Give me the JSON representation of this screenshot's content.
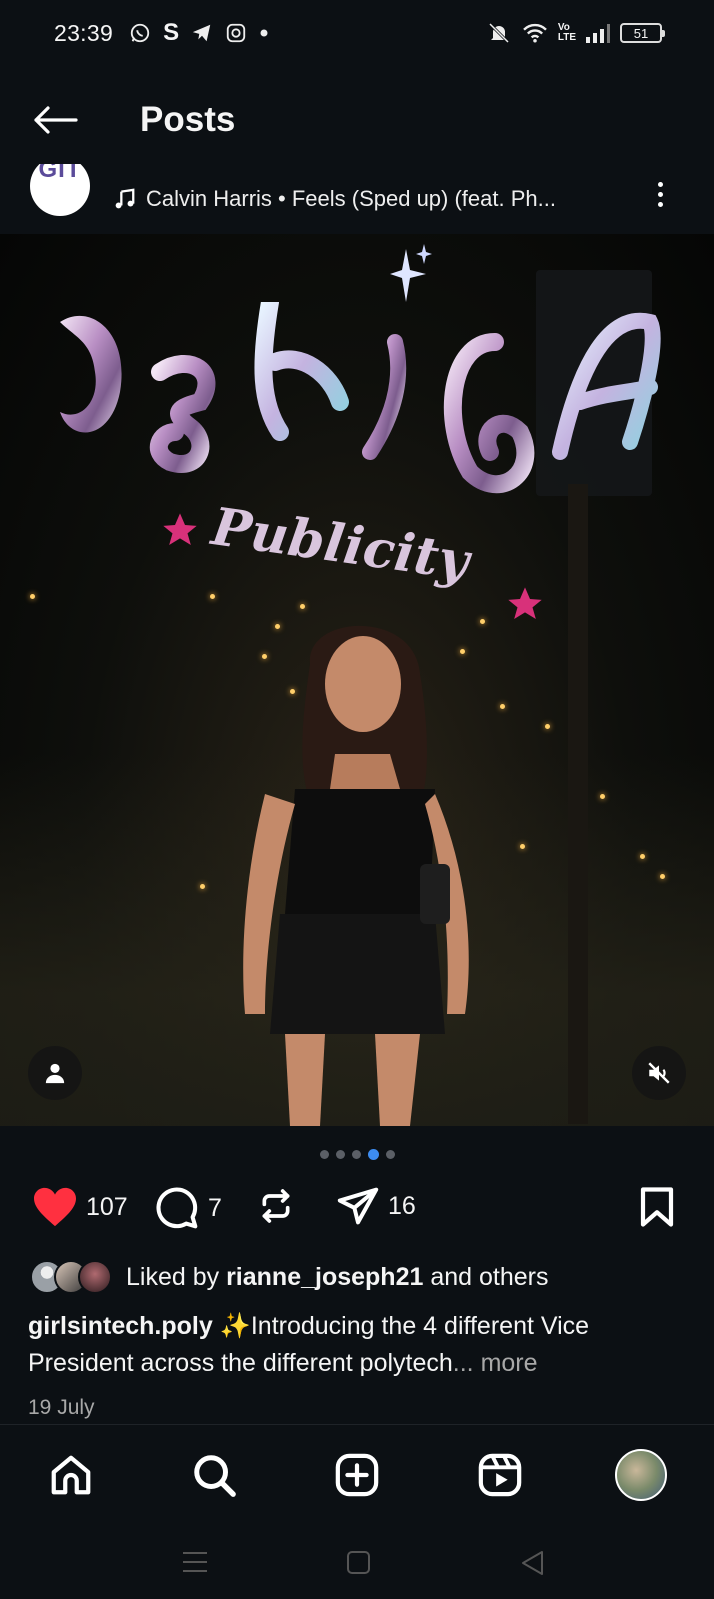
{
  "status_bar": {
    "time": "23:39",
    "battery": "51"
  },
  "header": {
    "title": "Posts"
  },
  "post": {
    "author_avatar_text": "GIT",
    "music": "Calvin Harris • Feels (Sped up) (feat. Ph...",
    "carousel": {
      "count": 5,
      "active_index": 3
    },
    "likes_count": "107",
    "comments_count": "7",
    "shares_count": "16",
    "liked_by_prefix": "Liked by",
    "liked_by_user": "rianne_joseph21",
    "liked_by_suffix": "and others",
    "caption_user": "girlsintech.poly",
    "caption_text": "✨Introducing the 4 different Vice President across the different polytech",
    "caption_more": "... more",
    "date": "19 July"
  },
  "icons": {
    "like": "heart-icon-filled",
    "comment": "comment-icon",
    "repost": "repost-icon",
    "share": "send-icon",
    "save": "bookmark-icon",
    "user_tags": "person-icon",
    "sound": "muted-speaker-icon"
  },
  "colors": {
    "like_red": "#ff3040",
    "active_dot": "#3d8cf0",
    "background": "#0c1014"
  }
}
